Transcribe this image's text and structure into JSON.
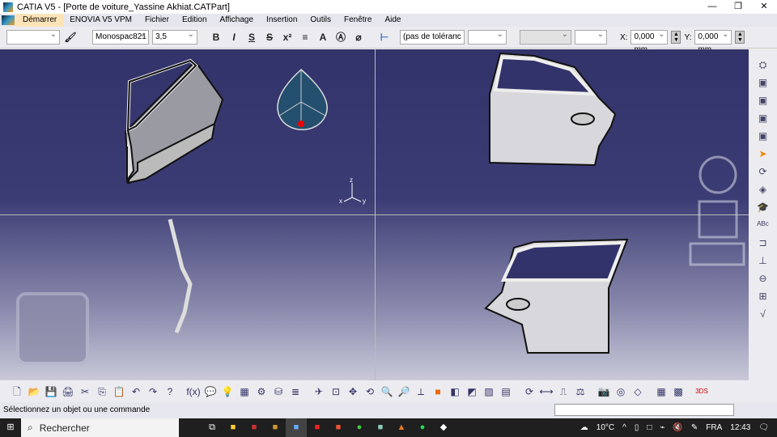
{
  "window": {
    "title": "CATIA V5 - [Porte de voiture_Yassine Akhiat.CATPart]",
    "minimize": "—",
    "restore": "❐",
    "close": "✕"
  },
  "menu": [
    "Démarrer",
    "ENOVIA V5 VPM",
    "Fichier",
    "Edition",
    "Affichage",
    "Insertion",
    "Outils",
    "Fenêtre",
    "Aide"
  ],
  "toolbar": {
    "style_combo": "",
    "font_combo": "Monospac821",
    "size_combo": "3,5",
    "bold": "B",
    "italic": "I",
    "underline": "S",
    "strike": "S",
    "superscript": "x²",
    "tolerance_combo": "(pas de toléranc",
    "x_label": "X:",
    "x_value": "0,000 mm",
    "y_label": "Y:",
    "y_value": "0,000 mm"
  },
  "compass": {
    "axis_z": "z",
    "axis_x": "x",
    "axis_y": "y"
  },
  "status": {
    "message": "Sélectionnez un objet ou une commande"
  },
  "taskbar": {
    "search_placeholder": "Rechercher",
    "weather": "10°C",
    "language": "FRA",
    "time": "12:43"
  }
}
